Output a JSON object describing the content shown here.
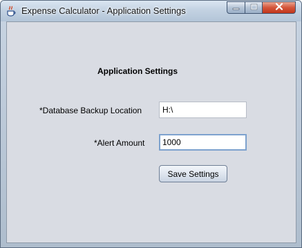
{
  "window": {
    "title": "Expense Calculator - Application Settings",
    "icon": "java-cup-icon",
    "controls": {
      "minimize_icon": "minimize-icon",
      "maximize_icon": "maximize-icon",
      "close_icon": "close-icon"
    }
  },
  "form": {
    "heading": "Application Settings",
    "backup_location_label": "*Database Backup Location",
    "backup_location_value": "H:\\",
    "alert_amount_label": "*Alert Amount",
    "alert_amount_value": "1000",
    "save_button_label": "Save Settings"
  },
  "colors": {
    "client_background": "#d9dce3",
    "close_button": "#c7432a",
    "focus_border": "#7da2ce"
  }
}
